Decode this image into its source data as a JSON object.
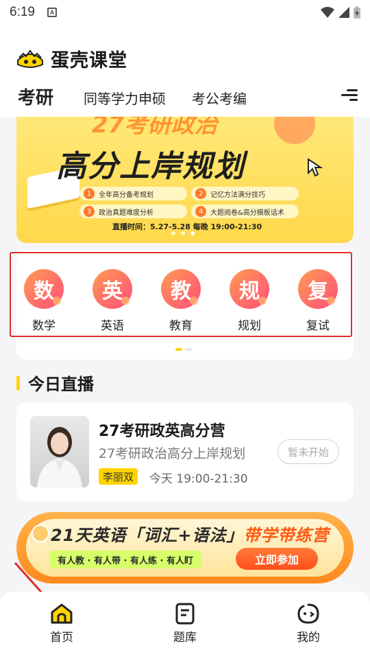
{
  "status_bar": {
    "time": "6:19",
    "notif_letter": "A"
  },
  "app": {
    "name": "蛋壳课堂"
  },
  "tabs": [
    {
      "label": "考研",
      "active": true
    },
    {
      "label": "同等学力申硕",
      "active": false
    },
    {
      "label": "考公考编",
      "active": false
    }
  ],
  "banner": {
    "top_text": "27考研政治",
    "title": "高分上岸规划",
    "items": [
      {
        "num": "1",
        "text": "全年高分备考规划"
      },
      {
        "num": "2",
        "text": "记忆方法满分技巧"
      },
      {
        "num": "3",
        "text": "政治真题难度分析"
      },
      {
        "num": "4",
        "text": "大题阅卷&高分模板话术"
      }
    ],
    "time": "直播时间：5.27-5.28 每晚 19:00-21:30"
  },
  "categories": [
    {
      "icon_char": "数",
      "label": "数学"
    },
    {
      "icon_char": "英",
      "label": "英语"
    },
    {
      "icon_char": "教",
      "label": "教育"
    },
    {
      "icon_char": "规",
      "label": "规划"
    },
    {
      "icon_char": "复",
      "label": "复试"
    }
  ],
  "section": {
    "title": "今日直播"
  },
  "live": {
    "title": "27考研政英高分营",
    "subtitle": "27考研政治高分上岸规划",
    "status": "暂未开始",
    "teacher": "李丽双",
    "time": "今天 19:00-21:30"
  },
  "promo": {
    "title_prefix": "21天英语「词汇+语法」",
    "title_highlight": "带学带练营",
    "tags": "有人教 · 有人带 · 有人练 · 有人盯",
    "button": "立即参加"
  },
  "tabbar": [
    {
      "label": "首页",
      "icon": "home-icon"
    },
    {
      "label": "题库",
      "icon": "question-bank-icon"
    },
    {
      "label": "我的",
      "icon": "profile-icon"
    }
  ],
  "colors": {
    "brand": "#ffd400",
    "accent": "#ff5a14",
    "highlight_box": "#e02c2c"
  }
}
